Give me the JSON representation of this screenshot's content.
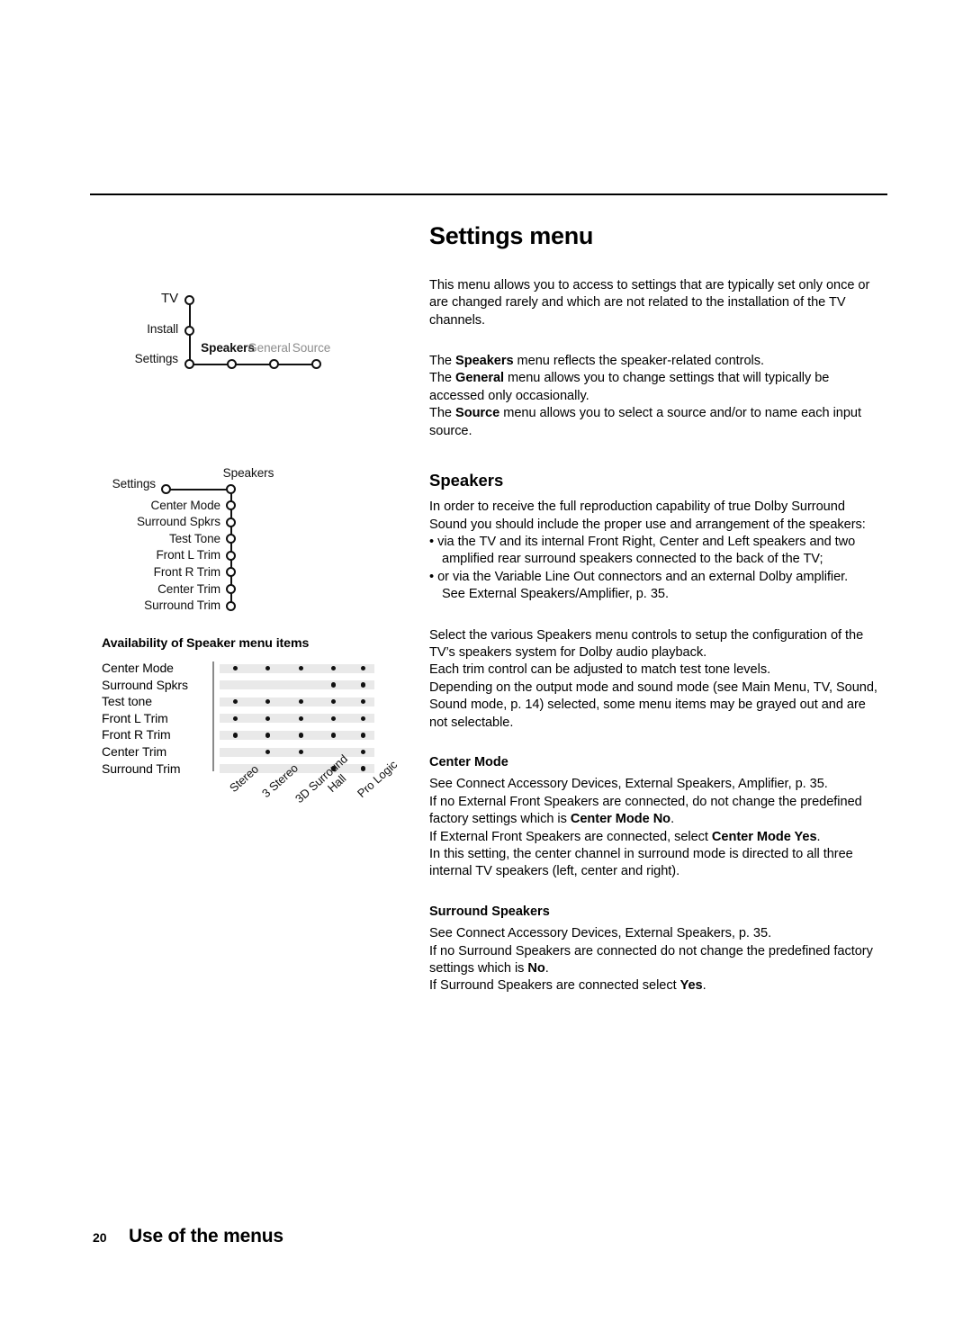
{
  "page": {
    "title": "Settings menu",
    "footer_page_number": "20",
    "footer_label": "Use of the menus"
  },
  "intro": {
    "paragraph_1": "This menu allows you to access to settings that are typically set only once or are changed rarely and which are not related to the installation of the TV channels.",
    "line_speakers_pre": "The ",
    "line_speakers_bold": "Speakers",
    "line_speakers_post": " menu reflects the speaker-related controls.",
    "line_general_pre": "The ",
    "line_general_bold": "General",
    "line_general_post": " menu allows you to change settings that will typically be accessed only occasionally.",
    "line_source_pre": "The ",
    "line_source_bold": "Source",
    "line_source_post": " menu allows you to select a source and/or to name each input source."
  },
  "speakers_section": {
    "heading": "Speakers",
    "intro": "In order to receive the full reproduction capability of true Dolby Surround Sound you should include the proper use and arrangement of the speakers:",
    "bullets": [
      {
        "marker": "•",
        "line1": "via the TV and its internal Front Right, Center and Left speakers and two",
        "line2": "amplified rear surround speakers connected to the back of the TV;"
      },
      {
        "marker": "•",
        "line1": "or via the Variable Line Out connectors and an external Dolby amplifier.",
        "line2": "See External Speakers/Amplifier, p. 35."
      }
    ],
    "paragraph_2": "Select the various Speakers menu controls to setup the configuration of the TV’s speakers system for Dolby audio playback.",
    "paragraph_3": "Each trim control can be adjusted to match test tone levels.",
    "paragraph_4": "Depending on the output mode and sound mode (see Main Menu, TV, Sound, Sound mode, p. 14) selected, some menu items may be grayed out and are not selectable."
  },
  "center_mode_section": {
    "heading": "Center Mode",
    "line_1": "See Connect Accessory Devices, External Speakers, Amplifier, p. 35.",
    "line_2_pre": "If no External Front Speakers are connected, do not change the predefined factory settings which is ",
    "line_2_bold": "Center Mode No",
    "line_2_post": ".",
    "line_3_pre": "If External Front Speakers are connected, select ",
    "line_3_bold": "Center Mode Yes",
    "line_3_post": ".",
    "line_4": "In this setting, the center channel in surround mode is directed to all three internal TV speakers (left, center and right)."
  },
  "surround_speakers_section": {
    "heading": "Surround Speakers",
    "line_1": "See Connect Accessory Devices, External Speakers, p. 35.",
    "line_2_pre": "If no Surround Speakers are connected do not change the predefined factory settings which is ",
    "line_2_bold": "No",
    "line_2_post": ".",
    "line_3_pre": "If Surround Speakers are connected select ",
    "line_3_bold": "Yes",
    "line_3_post": "."
  },
  "nav_diagram": {
    "vertical_nodes": [
      {
        "label": "TV"
      },
      {
        "label": "Install"
      },
      {
        "label": "Settings"
      }
    ],
    "horizontal_nodes": [
      {
        "label": "Speakers",
        "state": "active"
      },
      {
        "label": "General",
        "state": "dimmed"
      },
      {
        "label": "Source",
        "state": "dimmed"
      }
    ]
  },
  "speakers_tree": {
    "root_label": "Settings",
    "branch_label": "Speakers",
    "items": [
      {
        "label": "Center Mode"
      },
      {
        "label": "Surround Spkrs"
      },
      {
        "label": "Test Tone"
      },
      {
        "label": "Front L Trim"
      },
      {
        "label": "Front R Trim"
      },
      {
        "label": "Center Trim"
      },
      {
        "label": "Surround Trim"
      }
    ]
  },
  "availability_matrix": {
    "title": "Availability of Speaker menu items",
    "columns": [
      "Stereo",
      "3 Stereo",
      "3D Surround",
      "Hall",
      "Pro Logic"
    ],
    "rows": [
      {
        "label": "Center Mode",
        "available": [
          true,
          true,
          true,
          true,
          true
        ]
      },
      {
        "label": "Surround Spkrs",
        "available": [
          false,
          false,
          false,
          true,
          true
        ]
      },
      {
        "label": "Test tone",
        "available": [
          true,
          true,
          true,
          true,
          true
        ]
      },
      {
        "label": "Front L Trim",
        "available": [
          true,
          true,
          true,
          true,
          true
        ]
      },
      {
        "label": "Front R Trim",
        "available": [
          true,
          true,
          true,
          true,
          true
        ]
      },
      {
        "label": "Center Trim",
        "available": [
          false,
          true,
          true,
          false,
          true
        ]
      },
      {
        "label": "Surround  Trim",
        "available": [
          false,
          false,
          false,
          true,
          true
        ]
      }
    ],
    "colors": {
      "bar": "#e9e9e9",
      "dot": "#111111",
      "divider": "#8a8a8a"
    }
  }
}
